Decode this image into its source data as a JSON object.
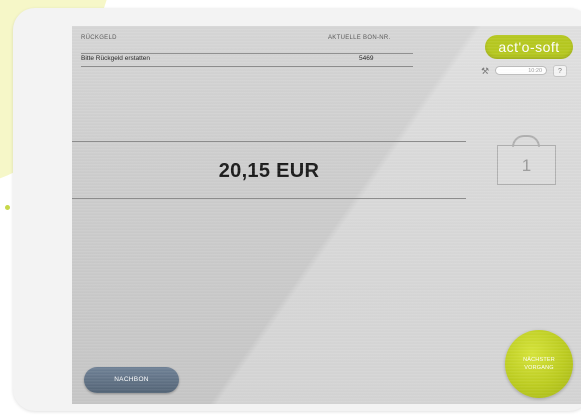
{
  "header": {
    "left_label": "RÜCKGELD",
    "right_label": "AKTUELLE BON-NR."
  },
  "row": {
    "message": "Bitte Rückgeld erstatten",
    "bon_number": "5469"
  },
  "logo": {
    "text": "act'o-soft"
  },
  "settings": {
    "small_field_value": "10:20",
    "help_label": "?"
  },
  "amount": {
    "text": "20,15 EUR"
  },
  "counter": {
    "value": "1"
  },
  "buttons": {
    "nachbon_label": "NACHBON",
    "next_label_line1": "NÄCHSTER",
    "next_label_line2": "VORGANG"
  },
  "colors": {
    "accent_green": "#b6c81f",
    "button_blue_gray": "#5f7185",
    "screen_gray": "#cdcdcd"
  },
  "icons": {
    "tool": "wrench-icon",
    "lock": "lock-icon"
  }
}
